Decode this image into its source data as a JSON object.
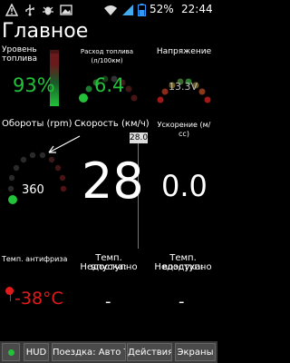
{
  "status": {
    "battery_percent": "52%",
    "time": "22:44",
    "icons": [
      "warning-icon",
      "usb-icon",
      "bug-icon",
      "image-icon",
      "wifi-icon",
      "signal-icon",
      "battery-icon"
    ]
  },
  "title": "Главное",
  "gauges": {
    "fuel_level": {
      "label": "Уровень топлива",
      "value": "93%",
      "fill": 0.93
    },
    "fuel_consumption": {
      "label": "Расход топлива (л/100км)",
      "value": "6.4"
    },
    "voltage": {
      "label": "Напряжение",
      "value": "13.3V"
    },
    "rpm": {
      "label": "Обороты (rpm)",
      "value": "360"
    },
    "speed": {
      "label": "Скорость (км/ч)",
      "value": "28",
      "badge": "28.0"
    },
    "acceleration": {
      "label": "Ускорение (м/сс)",
      "value": "0.0"
    },
    "coolant": {
      "label": "Темп. антифриза",
      "value": "-38°C"
    },
    "intake_temp": {
      "label": "Темп. впуска:",
      "status": "Недоступно",
      "value": "-"
    },
    "air_temp": {
      "label": "Темп. воздуха:",
      "status": "Недоступно",
      "value": "-"
    }
  },
  "bottom": {
    "hud": "HUD",
    "trip": "Поездка: Авто Тр",
    "actions": "Действия",
    "screens": "Экраны"
  },
  "colors": {
    "green": "#22c33a",
    "red": "#e21a1a",
    "dark_red": "#5a1414"
  }
}
